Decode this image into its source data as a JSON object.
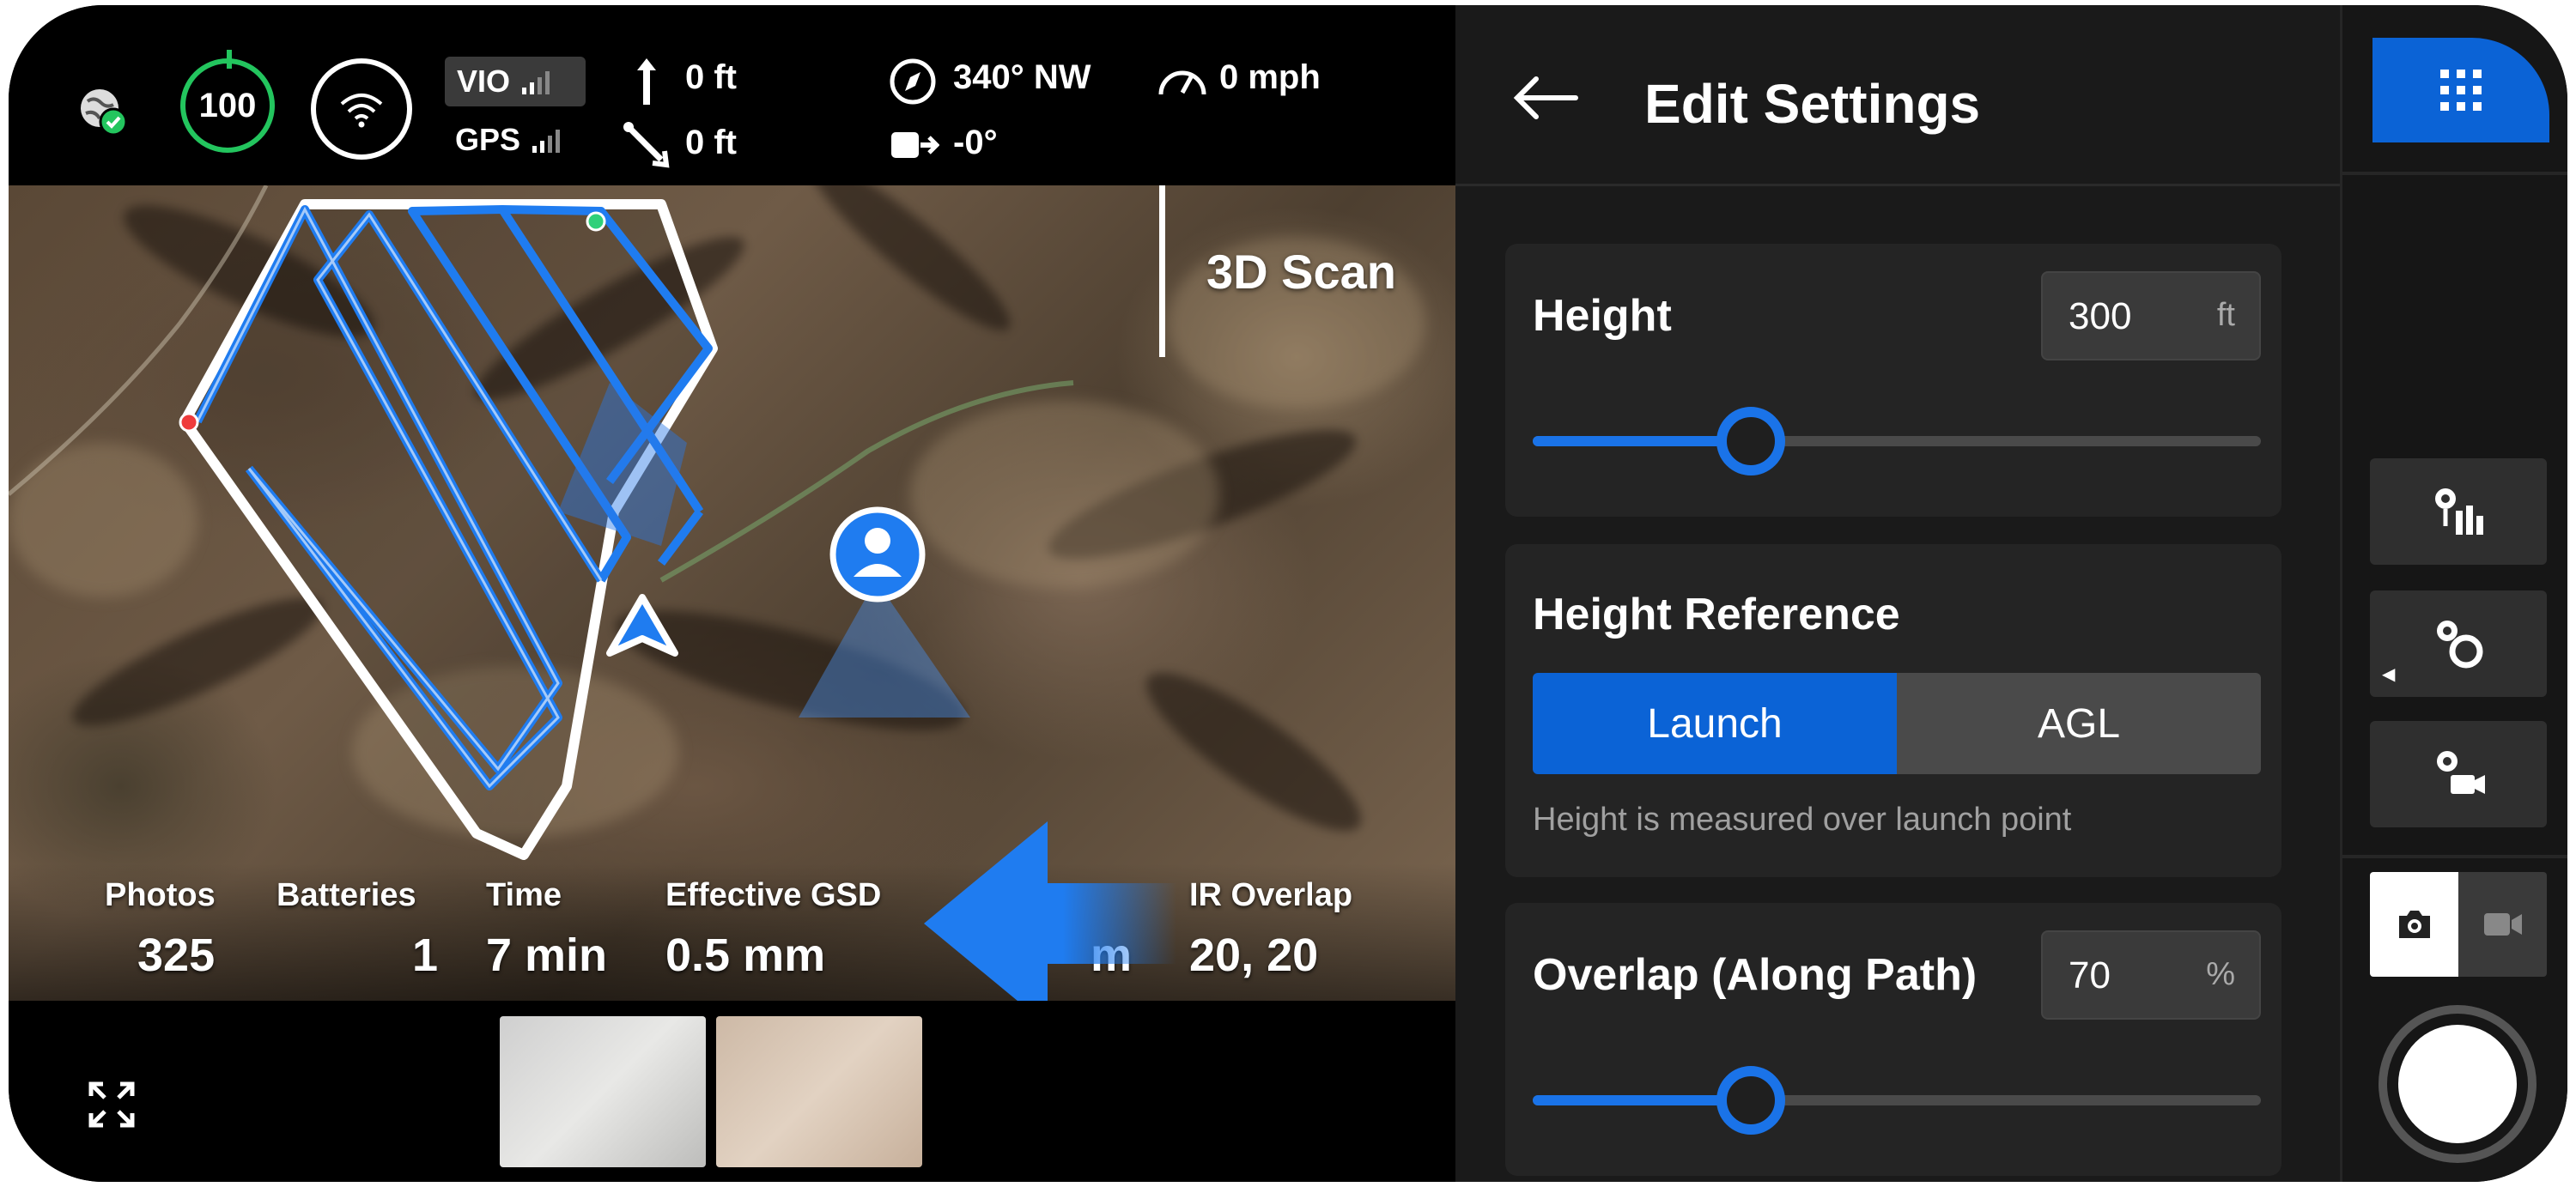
{
  "status": {
    "battery": "100",
    "vio_label": "VIO",
    "gps_label": "GPS",
    "altitude": "0 ft",
    "distance": "0 ft",
    "heading": "340° NW",
    "speed": "0 mph",
    "gimbal": "-0°"
  },
  "map": {
    "mission_label": "3D Scan",
    "stats": [
      {
        "label": "Photos",
        "value": "325"
      },
      {
        "label": "Batteries",
        "value": "1"
      },
      {
        "label": "Time",
        "value": "7 min"
      },
      {
        "label": "Effective GSD",
        "value": "0.5 mm"
      },
      {
        "label": "IR Overlap",
        "value": "20, 20"
      }
    ],
    "partial_value": "m"
  },
  "settings": {
    "title": "Edit Settings",
    "height": {
      "label": "Height",
      "value": "300",
      "unit": "ft",
      "slider_fraction": 0.3
    },
    "height_reference": {
      "label": "Height Reference",
      "options": [
        "Launch",
        "AGL"
      ],
      "selected": "Launch",
      "hint": "Height is measured over launch point"
    },
    "overlap": {
      "label": "Overlap (Along Path)",
      "value": "70",
      "unit": "%",
      "slider_fraction": 0.3
    }
  },
  "colors": {
    "accent": "#0b63d6",
    "battery_ok": "#23c55e",
    "panel_bg": "#1a1a1a",
    "card_bg": "#242424"
  },
  "icons": {
    "status": [
      "globe-check-icon",
      "wifi-signal-icon",
      "altitude-arrow-icon",
      "distance-icon",
      "compass-icon",
      "speedometer-icon",
      "gimbal-icon"
    ],
    "rail": [
      "apps-grid-icon",
      "waypoint-mode-icon",
      "orbit-mode-icon",
      "follow-mode-icon",
      "photo-camera-icon",
      "video-camera-icon"
    ]
  }
}
